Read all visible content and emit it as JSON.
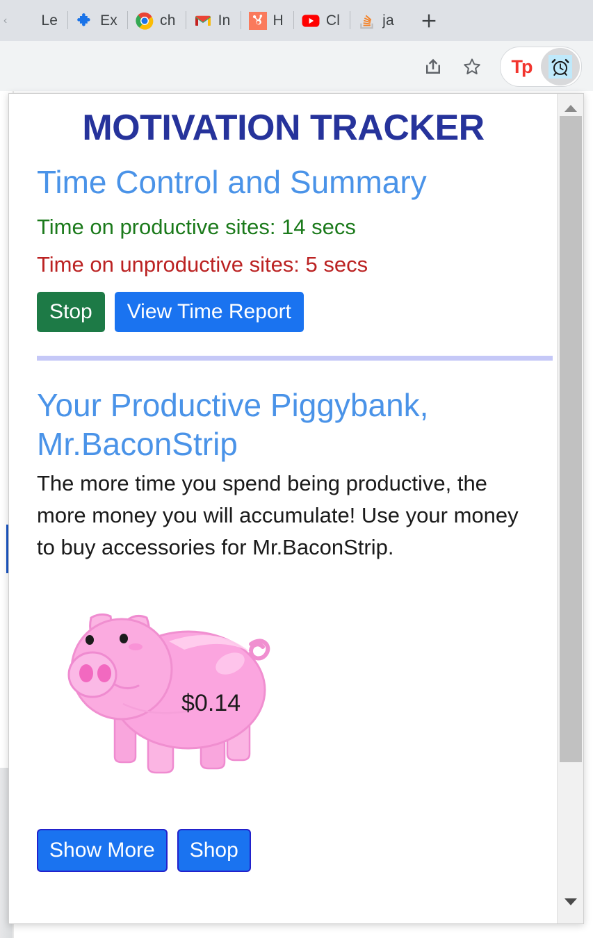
{
  "browser": {
    "tabs": [
      {
        "label": "Le",
        "icon": "generic-page-icon"
      },
      {
        "label": "Ex",
        "icon": "puzzle-piece-icon"
      },
      {
        "label": "ch",
        "icon": "chrome-icon"
      },
      {
        "label": "In",
        "icon": "gmail-icon"
      },
      {
        "label": "H",
        "icon": "hubspot-icon"
      },
      {
        "label": "Cl",
        "icon": "youtube-icon"
      },
      {
        "label": "ja",
        "icon": "stackoverflow-icon"
      }
    ],
    "new_tab_label": "+",
    "toolbar": {
      "share_icon": "share-icon",
      "bookmark_icon": "star-icon",
      "extension_tp_label": "Tp",
      "extension_alarm_icon": "alarm-clock-icon"
    }
  },
  "popup": {
    "title": "MOTIVATION TRACKER",
    "section_time": {
      "heading": "Time Control and Summary",
      "productive_text": "Time on productive sites: 14 secs",
      "unproductive_text": "Time on unproductive sites: 5 secs",
      "stop_button": "Stop",
      "report_button": "View Time Report"
    },
    "section_piggy": {
      "heading": "Your Productive Piggybank, Mr.BaconStrip",
      "description": "The more time you spend being productive, the more money you will accumulate! Use your money to buy accessories for Mr.BaconStrip.",
      "balance": "$0.14",
      "pig_icon": "piggybank-icon",
      "show_more_button": "Show More",
      "shop_button": "Shop"
    },
    "scrollbar": {
      "up_icon": "scroll-up-arrow-icon",
      "down_icon": "scroll-down-arrow-icon"
    }
  },
  "colors": {
    "title_navy": "#26339b",
    "heading_blue": "#4a93e8",
    "productive_green": "#1b7a1b",
    "unproductive_red": "#bb2222",
    "primary_blue": "#1a73f0",
    "stop_green": "#1d7a46",
    "divider_lavender": "#c5c8f7",
    "pig_pink": "#f8a0d8"
  }
}
